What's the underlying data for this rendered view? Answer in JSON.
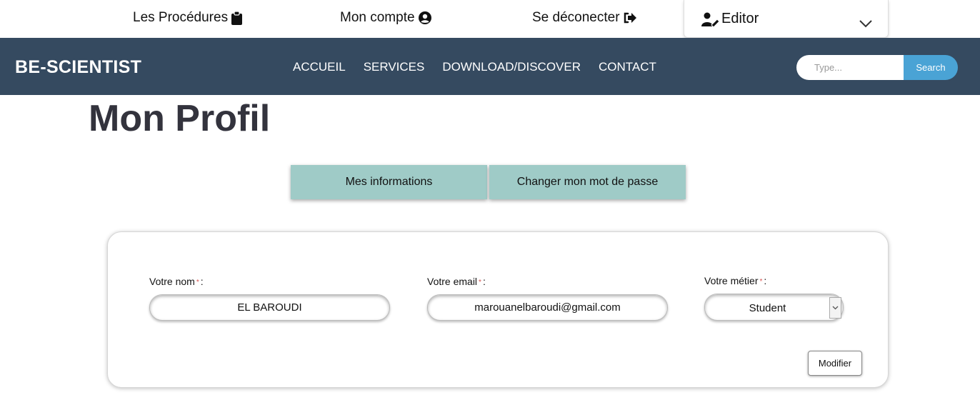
{
  "topbar": {
    "procedures_label": "Les Procédures",
    "account_label": "Mon compte",
    "logout_label": "Se déconecter",
    "role_label": "Editor"
  },
  "navbar": {
    "brand": "BE-SCIENTIST",
    "links": [
      "ACCUEIL",
      "SERVICES",
      "DOWNLOAD/DISCOVER",
      "CONTACT"
    ],
    "search_placeholder": "Type...",
    "search_button": "Search"
  },
  "page": {
    "title": "Mon Profil"
  },
  "tabs": [
    {
      "label": "Mes informations"
    },
    {
      "label": "Changer mon mot de passe"
    }
  ],
  "form": {
    "name_label": "Votre nom",
    "name_value": "EL BAROUDI",
    "email_label": "Votre email",
    "email_value": "marouanelbaroudi@gmail.com",
    "job_label": "Votre métier",
    "job_value": "Student",
    "required_mark": "*",
    "label_suffix": ":",
    "submit_label": "Modifier"
  },
  "colors": {
    "navbar_bg": "#354a60",
    "tab_bg": "#9fcbc7",
    "search_button_bg": "#4aa3d5",
    "required_mark": "#d9534f"
  },
  "icons": {
    "procedures": "clipboard-icon",
    "account": "user-circle-icon",
    "logout": "sign-out-icon",
    "role": "user-edit-icon",
    "dropdown": "chevron-down-icon"
  }
}
